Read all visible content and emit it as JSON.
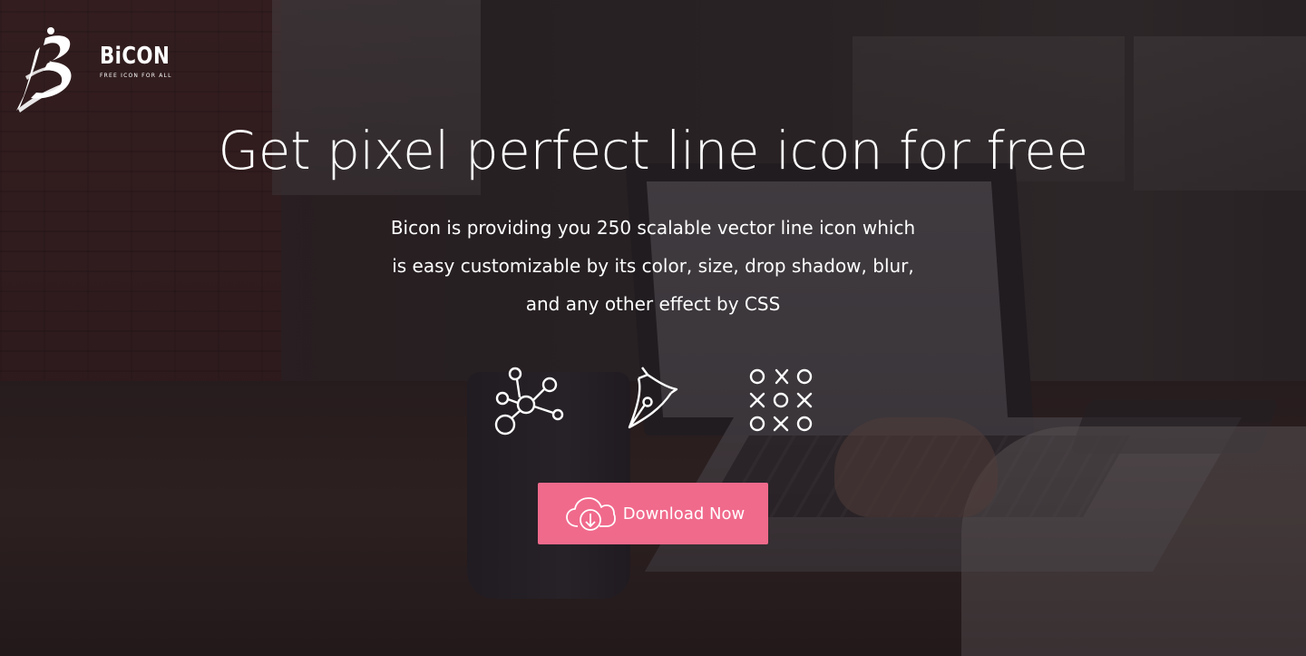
{
  "brand": {
    "name": "BiCON",
    "tagline": "FREE ICON FOR ALL",
    "logo_icon": "brush-b-logo-icon"
  },
  "hero": {
    "title": "Get pixel perfect line icon for free",
    "description": "Bicon is providing you 250 scalable vector line icon which is easy customizable by its color, size, drop shadow, blur, and any other effect by CSS"
  },
  "icons": [
    {
      "name": "molecule-network-icon"
    },
    {
      "name": "pen-nib-icon"
    },
    {
      "name": "tic-tac-toe-icon"
    }
  ],
  "cta": {
    "label": "Download Now",
    "icon": "cloud-download-icon"
  },
  "colors": {
    "accent": "#f06a8c",
    "text": "#ffffff",
    "overlay": "#1c141a"
  }
}
